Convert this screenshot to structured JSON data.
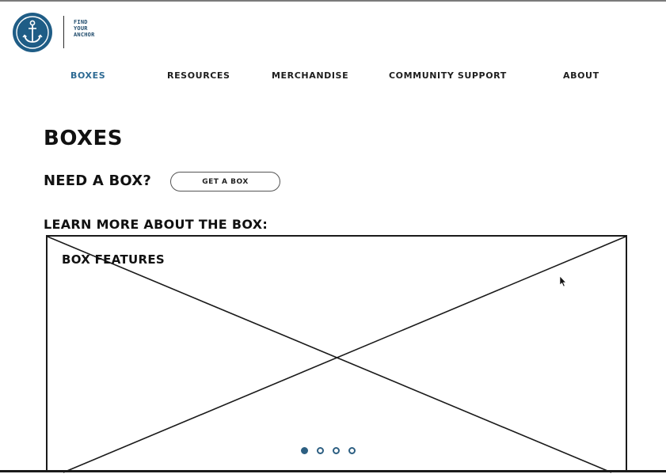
{
  "brand": {
    "logo_icon": "anchor-icon",
    "logo_color": "#1f5d86",
    "name_lines": [
      "FIND",
      "YOUR",
      "ANCHOR"
    ]
  },
  "nav": {
    "active_color": "#2d6a93",
    "items": [
      {
        "label": "BOXES",
        "active": true
      },
      {
        "label": "RESOURCES",
        "active": false
      },
      {
        "label": "MERCHANDISE",
        "active": false
      },
      {
        "label": "COMMUNITY SUPPORT",
        "active": false
      },
      {
        "label": "ABOUT",
        "active": false
      }
    ]
  },
  "page": {
    "title": "BOXES",
    "need_box_label": "NEED A BOX?",
    "get_box_button": "GET A BOX",
    "learn_more_label": "LEARN MORE ABOUT THE BOX:"
  },
  "carousel": {
    "title": "BOX FEATURES",
    "slide_count": 4,
    "active_slide": 1,
    "dot_color": "#2d5f82"
  }
}
